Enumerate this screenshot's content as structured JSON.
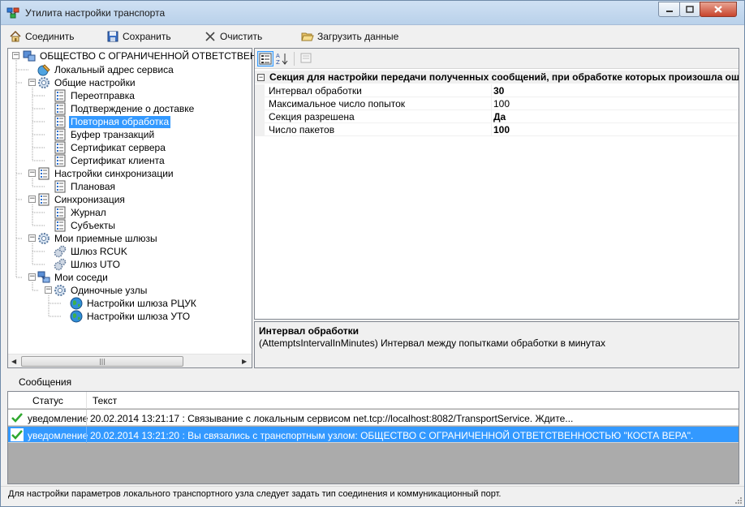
{
  "window": {
    "title": "Утилита настройки транспорта"
  },
  "toolbar": {
    "connect_label": "Соединить",
    "save_label": "Сохранить",
    "clear_label": "Очистить",
    "load_label": "Загрузить данные"
  },
  "tree": {
    "nodes": [
      {
        "label": "ОБЩЕСТВО С ОГРАНИЧЕННОЙ ОТВЕТСТВЕННО",
        "icon": "server-network-icon"
      },
      {
        "label": "Локальный адрес сервиса",
        "icon": "globe-pencil-icon"
      },
      {
        "label": "Общие настройки",
        "icon": "gear-icon"
      },
      {
        "label": "Переотправка",
        "icon": "form-icon"
      },
      {
        "label": "Подтверждение о доставке",
        "icon": "form-icon"
      },
      {
        "label": "Повторная обработка",
        "icon": "form-icon"
      },
      {
        "label": "Буфер транзакций",
        "icon": "form-icon"
      },
      {
        "label": "Сертификат сервера",
        "icon": "form-icon"
      },
      {
        "label": "Сертификат клиента",
        "icon": "form-icon"
      },
      {
        "label": "Настройки синхронизации",
        "icon": "form-icon"
      },
      {
        "label": "Плановая",
        "icon": "form-icon"
      },
      {
        "label": "Синхронизация",
        "icon": "form-icon"
      },
      {
        "label": "Журнал",
        "icon": "form-icon"
      },
      {
        "label": "Субъекты",
        "icon": "form-icon"
      },
      {
        "label": "Мои приемные шлюзы",
        "icon": "gear-icon"
      },
      {
        "label": "Шлюз RCUK",
        "icon": "gears-icon"
      },
      {
        "label": "Шлюз UTO",
        "icon": "gears-icon"
      },
      {
        "label": "Мои соседи",
        "icon": "network-icon"
      },
      {
        "label": "Одиночные узлы",
        "icon": "gear-icon"
      },
      {
        "label": "Настройки шлюза РЦУК",
        "icon": "globe-icon"
      },
      {
        "label": "Настройки шлюза УТО",
        "icon": "globe-icon"
      }
    ],
    "selected": "Повторная обработка"
  },
  "propgrid": {
    "category": "Секция для настройки передачи полученных сообщений, при обработке которых произошла  оши",
    "rows": [
      {
        "name": "Интервал обработки",
        "value": "30",
        "bold": true
      },
      {
        "name": "Максимальное число попыток",
        "value": "100",
        "bold": false
      },
      {
        "name": "Секция разрешена",
        "value": "Да",
        "bold": true
      },
      {
        "name": "Число пакетов",
        "value": "100",
        "bold": true
      }
    ],
    "description_title": "Интервал обработки",
    "description_text": "(AttemptsIntervalInMinutes) Интервал между попытками обработки в минутах"
  },
  "messages": {
    "label": "Сообщения",
    "columns": [
      "Статус",
      "Текст"
    ],
    "rows": [
      {
        "status": "уведомление",
        "text": "20.02.2014 13:21:17 : Связывание с локальным сервисом net.tcp://localhost:8082/TransportService. Ждите...",
        "icon": "check-icon"
      },
      {
        "status": "уведомление",
        "text": "20.02.2014 13:21:20 : Вы связались с транспортным узлом: ОБЩЕСТВО С ОГРАНИЧЕННОЙ ОТВЕТСТВЕННОСТЬЮ \"КОСТА ВЕРА\".",
        "icon": "check-icon"
      }
    ]
  },
  "statusbar": {
    "text": "Для настройки параметров локального транспортного узла следует задать тип соединения и коммуникационный порт."
  },
  "colors": {
    "selection": "#3399ff",
    "window_bg": "#f0f0f0"
  }
}
